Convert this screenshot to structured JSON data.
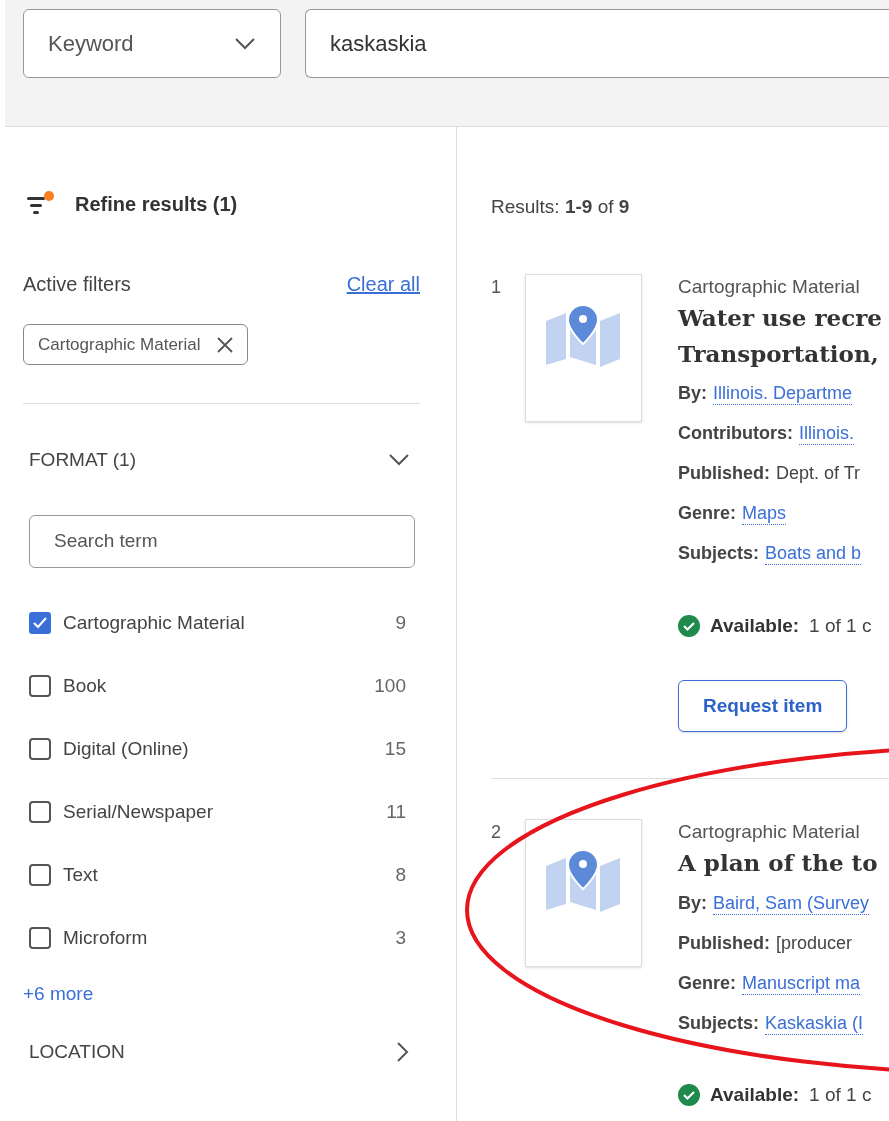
{
  "search": {
    "type_select": "Keyword",
    "query": "kaskaskia"
  },
  "sidebar": {
    "heading": "Refine results (1)",
    "active_filters_label": "Active filters",
    "clear_all": "Clear all",
    "active_filters": [
      {
        "label": "Cartographic Material"
      }
    ],
    "facets": [
      {
        "title": "FORMAT (1)",
        "expanded": true,
        "search_placeholder": "Search term",
        "more": "+6 more",
        "options": [
          {
            "label": "Cartographic Material",
            "count": "9",
            "checked": true
          },
          {
            "label": "Book",
            "count": "100",
            "checked": false
          },
          {
            "label": "Digital (Online)",
            "count": "15",
            "checked": false
          },
          {
            "label": "Serial/Newspaper",
            "count": "11",
            "checked": false
          },
          {
            "label": "Text",
            "count": "8",
            "checked": false
          },
          {
            "label": "Microform",
            "count": "3",
            "checked": false
          }
        ]
      },
      {
        "title": "LOCATION",
        "expanded": false
      }
    ]
  },
  "results": {
    "summary": "Results: **1-9** of **9**",
    "items": [
      {
        "number": "1",
        "format": "Cartographic Material",
        "title_lines": [
          "Water use recre",
          "Transportation,"
        ],
        "fields": [
          {
            "label": "By:",
            "value": "Illinois. Departme",
            "link": true
          },
          {
            "label": "Contributors:",
            "value": "Illinois.",
            "link": true
          },
          {
            "label": "Published:",
            "value": "Dept. of Tr",
            "link": false
          },
          {
            "label": "Genre:",
            "value": "Maps",
            "link": true
          },
          {
            "label": "Subjects:",
            "value": "Boats and b",
            "link": true
          }
        ],
        "availability": {
          "label": "Available:",
          "text": "1 of 1 c"
        },
        "button": "Request item"
      },
      {
        "number": "2",
        "format": "Cartographic Material",
        "title_lines": [
          "A plan of the to"
        ],
        "fields": [
          {
            "label": "By:",
            "value": "Baird, Sam (Survey",
            "link": true
          },
          {
            "label": "Published:",
            "value": "[producer",
            "link": false
          },
          {
            "label": "Genre:",
            "value": "Manuscript ma",
            "link": true
          },
          {
            "label": "Subjects:",
            "value": "Kaskaskia (I",
            "link": true
          }
        ],
        "availability": {
          "label": "Available:",
          "text": "1 of 1 c"
        }
      }
    ]
  }
}
